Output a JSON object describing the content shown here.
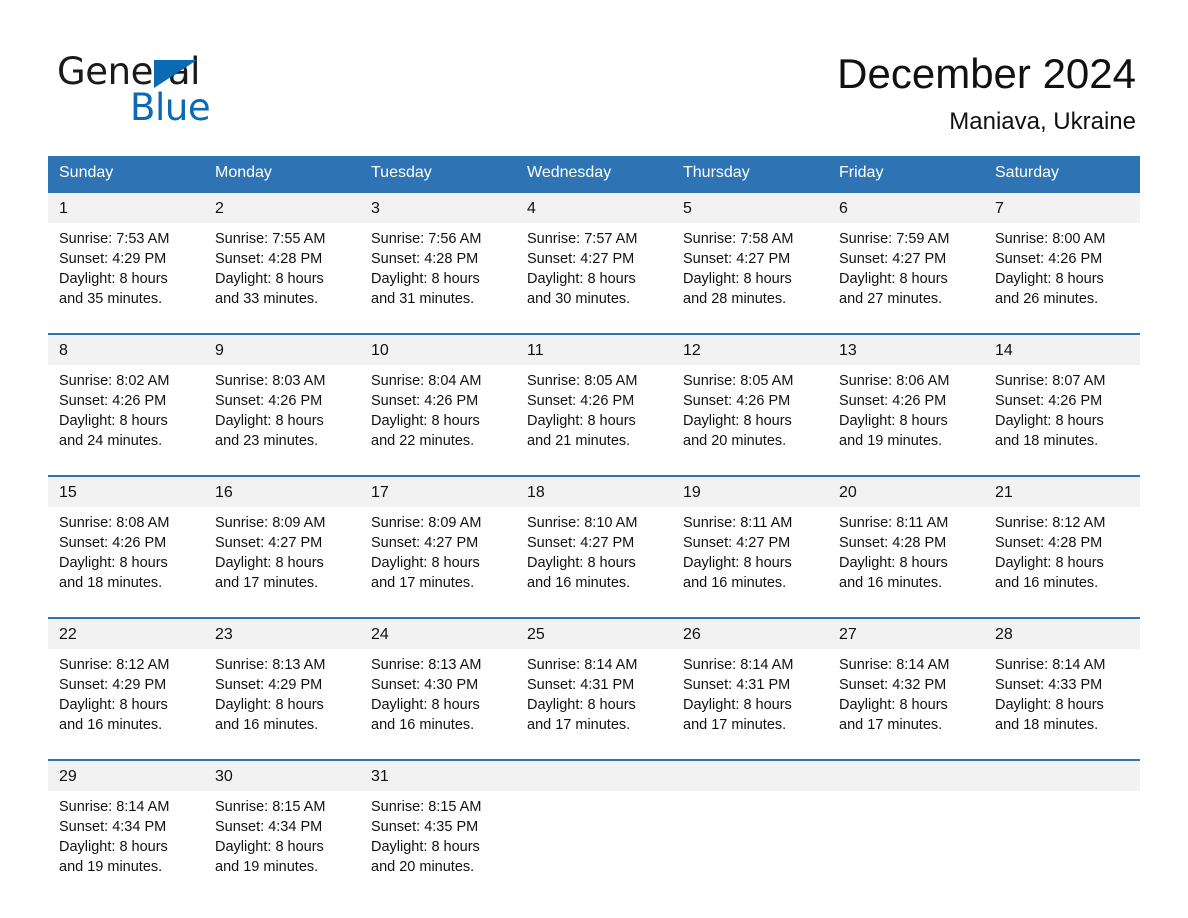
{
  "brand": {
    "name_part1": "General",
    "name_part2": "Blue",
    "triangle_color": "#0a6ab4"
  },
  "header": {
    "title": "December 2024",
    "location": "Maniava, Ukraine"
  },
  "theme": {
    "header_blue": "#2e74b5",
    "daynum_band": "#f2f2f2",
    "text": "#111111"
  },
  "calendar": {
    "weekday_headers": [
      "Sunday",
      "Monday",
      "Tuesday",
      "Wednesday",
      "Thursday",
      "Friday",
      "Saturday"
    ],
    "weeks": [
      [
        {
          "day": "1",
          "sunrise": "Sunrise: 7:53 AM",
          "sunset": "Sunset: 4:29 PM",
          "daylight1": "Daylight: 8 hours",
          "daylight2": "and 35 minutes."
        },
        {
          "day": "2",
          "sunrise": "Sunrise: 7:55 AM",
          "sunset": "Sunset: 4:28 PM",
          "daylight1": "Daylight: 8 hours",
          "daylight2": "and 33 minutes."
        },
        {
          "day": "3",
          "sunrise": "Sunrise: 7:56 AM",
          "sunset": "Sunset: 4:28 PM",
          "daylight1": "Daylight: 8 hours",
          "daylight2": "and 31 minutes."
        },
        {
          "day": "4",
          "sunrise": "Sunrise: 7:57 AM",
          "sunset": "Sunset: 4:27 PM",
          "daylight1": "Daylight: 8 hours",
          "daylight2": "and 30 minutes."
        },
        {
          "day": "5",
          "sunrise": "Sunrise: 7:58 AM",
          "sunset": "Sunset: 4:27 PM",
          "daylight1": "Daylight: 8 hours",
          "daylight2": "and 28 minutes."
        },
        {
          "day": "6",
          "sunrise": "Sunrise: 7:59 AM",
          "sunset": "Sunset: 4:27 PM",
          "daylight1": "Daylight: 8 hours",
          "daylight2": "and 27 minutes."
        },
        {
          "day": "7",
          "sunrise": "Sunrise: 8:00 AM",
          "sunset": "Sunset: 4:26 PM",
          "daylight1": "Daylight: 8 hours",
          "daylight2": "and 26 minutes."
        }
      ],
      [
        {
          "day": "8",
          "sunrise": "Sunrise: 8:02 AM",
          "sunset": "Sunset: 4:26 PM",
          "daylight1": "Daylight: 8 hours",
          "daylight2": "and 24 minutes."
        },
        {
          "day": "9",
          "sunrise": "Sunrise: 8:03 AM",
          "sunset": "Sunset: 4:26 PM",
          "daylight1": "Daylight: 8 hours",
          "daylight2": "and 23 minutes."
        },
        {
          "day": "10",
          "sunrise": "Sunrise: 8:04 AM",
          "sunset": "Sunset: 4:26 PM",
          "daylight1": "Daylight: 8 hours",
          "daylight2": "and 22 minutes."
        },
        {
          "day": "11",
          "sunrise": "Sunrise: 8:05 AM",
          "sunset": "Sunset: 4:26 PM",
          "daylight1": "Daylight: 8 hours",
          "daylight2": "and 21 minutes."
        },
        {
          "day": "12",
          "sunrise": "Sunrise: 8:05 AM",
          "sunset": "Sunset: 4:26 PM",
          "daylight1": "Daylight: 8 hours",
          "daylight2": "and 20 minutes."
        },
        {
          "day": "13",
          "sunrise": "Sunrise: 8:06 AM",
          "sunset": "Sunset: 4:26 PM",
          "daylight1": "Daylight: 8 hours",
          "daylight2": "and 19 minutes."
        },
        {
          "day": "14",
          "sunrise": "Sunrise: 8:07 AM",
          "sunset": "Sunset: 4:26 PM",
          "daylight1": "Daylight: 8 hours",
          "daylight2": "and 18 minutes."
        }
      ],
      [
        {
          "day": "15",
          "sunrise": "Sunrise: 8:08 AM",
          "sunset": "Sunset: 4:26 PM",
          "daylight1": "Daylight: 8 hours",
          "daylight2": "and 18 minutes."
        },
        {
          "day": "16",
          "sunrise": "Sunrise: 8:09 AM",
          "sunset": "Sunset: 4:27 PM",
          "daylight1": "Daylight: 8 hours",
          "daylight2": "and 17 minutes."
        },
        {
          "day": "17",
          "sunrise": "Sunrise: 8:09 AM",
          "sunset": "Sunset: 4:27 PM",
          "daylight1": "Daylight: 8 hours",
          "daylight2": "and 17 minutes."
        },
        {
          "day": "18",
          "sunrise": "Sunrise: 8:10 AM",
          "sunset": "Sunset: 4:27 PM",
          "daylight1": "Daylight: 8 hours",
          "daylight2": "and 16 minutes."
        },
        {
          "day": "19",
          "sunrise": "Sunrise: 8:11 AM",
          "sunset": "Sunset: 4:27 PM",
          "daylight1": "Daylight: 8 hours",
          "daylight2": "and 16 minutes."
        },
        {
          "day": "20",
          "sunrise": "Sunrise: 8:11 AM",
          "sunset": "Sunset: 4:28 PM",
          "daylight1": "Daylight: 8 hours",
          "daylight2": "and 16 minutes."
        },
        {
          "day": "21",
          "sunrise": "Sunrise: 8:12 AM",
          "sunset": "Sunset: 4:28 PM",
          "daylight1": "Daylight: 8 hours",
          "daylight2": "and 16 minutes."
        }
      ],
      [
        {
          "day": "22",
          "sunrise": "Sunrise: 8:12 AM",
          "sunset": "Sunset: 4:29 PM",
          "daylight1": "Daylight: 8 hours",
          "daylight2": "and 16 minutes."
        },
        {
          "day": "23",
          "sunrise": "Sunrise: 8:13 AM",
          "sunset": "Sunset: 4:29 PM",
          "daylight1": "Daylight: 8 hours",
          "daylight2": "and 16 minutes."
        },
        {
          "day": "24",
          "sunrise": "Sunrise: 8:13 AM",
          "sunset": "Sunset: 4:30 PM",
          "daylight1": "Daylight: 8 hours",
          "daylight2": "and 16 minutes."
        },
        {
          "day": "25",
          "sunrise": "Sunrise: 8:14 AM",
          "sunset": "Sunset: 4:31 PM",
          "daylight1": "Daylight: 8 hours",
          "daylight2": "and 17 minutes."
        },
        {
          "day": "26",
          "sunrise": "Sunrise: 8:14 AM",
          "sunset": "Sunset: 4:31 PM",
          "daylight1": "Daylight: 8 hours",
          "daylight2": "and 17 minutes."
        },
        {
          "day": "27",
          "sunrise": "Sunrise: 8:14 AM",
          "sunset": "Sunset: 4:32 PM",
          "daylight1": "Daylight: 8 hours",
          "daylight2": "and 17 minutes."
        },
        {
          "day": "28",
          "sunrise": "Sunrise: 8:14 AM",
          "sunset": "Sunset: 4:33 PM",
          "daylight1": "Daylight: 8 hours",
          "daylight2": "and 18 minutes."
        }
      ],
      [
        {
          "day": "29",
          "sunrise": "Sunrise: 8:14 AM",
          "sunset": "Sunset: 4:34 PM",
          "daylight1": "Daylight: 8 hours",
          "daylight2": "and 19 minutes."
        },
        {
          "day": "30",
          "sunrise": "Sunrise: 8:15 AM",
          "sunset": "Sunset: 4:34 PM",
          "daylight1": "Daylight: 8 hours",
          "daylight2": "and 19 minutes."
        },
        {
          "day": "31",
          "sunrise": "Sunrise: 8:15 AM",
          "sunset": "Sunset: 4:35 PM",
          "daylight1": "Daylight: 8 hours",
          "daylight2": "and 20 minutes."
        },
        {
          "day": "",
          "sunrise": "",
          "sunset": "",
          "daylight1": "",
          "daylight2": ""
        },
        {
          "day": "",
          "sunrise": "",
          "sunset": "",
          "daylight1": "",
          "daylight2": ""
        },
        {
          "day": "",
          "sunrise": "",
          "sunset": "",
          "daylight1": "",
          "daylight2": ""
        },
        {
          "day": "",
          "sunrise": "",
          "sunset": "",
          "daylight1": "",
          "daylight2": ""
        }
      ]
    ]
  }
}
